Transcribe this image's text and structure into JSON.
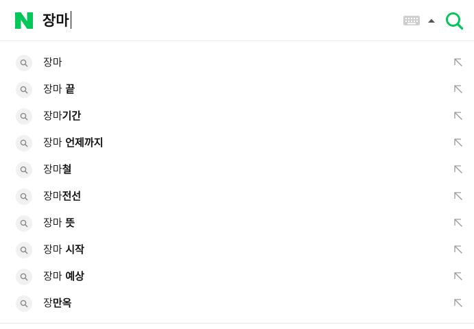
{
  "brand": {
    "logo_icon": "naver-n-logo",
    "color": "#03c75a"
  },
  "search": {
    "query": "장마",
    "keyboard_icon": "keyboard-icon",
    "toggle_icon": "triangle-up-icon",
    "button_icon": "search-icon"
  },
  "suggestions": [
    {
      "prefix": "장마",
      "rest": ""
    },
    {
      "prefix": "장마 ",
      "rest": "끝"
    },
    {
      "prefix": "장마",
      "rest": "기간"
    },
    {
      "prefix": "장마 ",
      "rest": "언제까지"
    },
    {
      "prefix": "장마",
      "rest": "철"
    },
    {
      "prefix": "장마",
      "rest": "전선"
    },
    {
      "prefix": "장마 ",
      "rest": "뜻"
    },
    {
      "prefix": "장마 ",
      "rest": "시작"
    },
    {
      "prefix": "장마 ",
      "rest": "예상"
    },
    {
      "prefix": "장",
      "rest": "만옥"
    }
  ]
}
